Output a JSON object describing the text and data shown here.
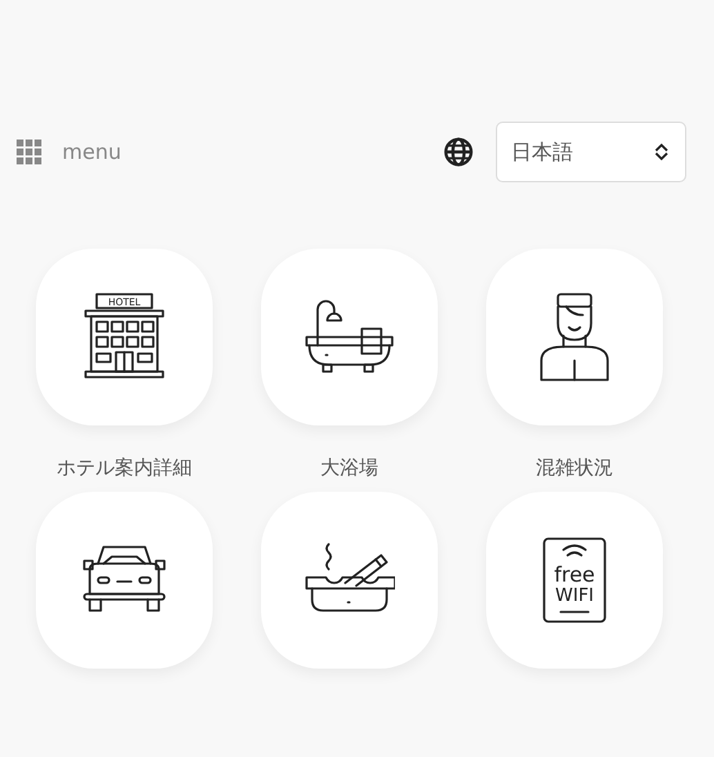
{
  "header": {
    "menu_label": "menu",
    "language": {
      "value": "日本語"
    }
  },
  "tiles": [
    {
      "kind": "hotel",
      "label": "ホテル案内詳細",
      "icon_text": [
        "HOTEL"
      ]
    },
    {
      "kind": "bath",
      "label": "大浴場"
    },
    {
      "kind": "staff",
      "label": "混雑状況"
    },
    {
      "kind": "car"
    },
    {
      "kind": "ashtray"
    },
    {
      "kind": "wifi",
      "icon_text": [
        "free",
        "WIFI"
      ]
    }
  ]
}
